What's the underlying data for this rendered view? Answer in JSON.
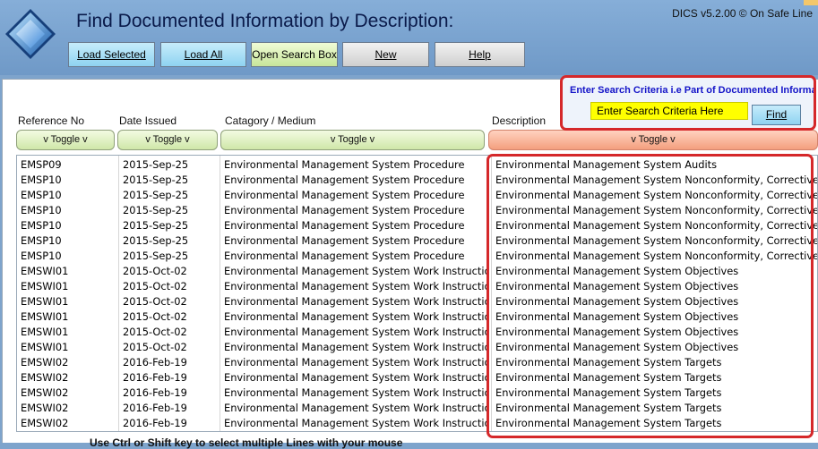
{
  "window": {
    "title": "Find Documented Information by Description:",
    "version": "DICS v5.2.00 © On Safe Line"
  },
  "toolbar": {
    "load_selected": "Load Selected",
    "load_all": "Load All",
    "open_search_box": "Open Search Box",
    "new": "New",
    "help": "Help"
  },
  "columns": {
    "reference": "Reference No",
    "date": "Date Issued",
    "category": "Catagory / Medium",
    "description": "Description",
    "toggle_label": "v Toggle v"
  },
  "search": {
    "label": "Enter Search Criteria i.e Part of Documented Information",
    "placeholder": "Enter Search Criteria Here",
    "find_label": "Find"
  },
  "rows": [
    {
      "ref": "EMSP09",
      "date": "2015-Sep-25",
      "cat": "Environmental Management System Procedure",
      "desc": "Environmental Management System Audits"
    },
    {
      "ref": "EMSP10",
      "date": "2015-Sep-25",
      "cat": "Environmental Management System Procedure",
      "desc": "Environmental Management System Nonconformity, Corrective Action"
    },
    {
      "ref": "EMSP10",
      "date": "2015-Sep-25",
      "cat": "Environmental Management System Procedure",
      "desc": "Environmental Management System Nonconformity, Corrective Action"
    },
    {
      "ref": "EMSP10",
      "date": "2015-Sep-25",
      "cat": "Environmental Management System Procedure",
      "desc": "Environmental Management System Nonconformity, Corrective Action"
    },
    {
      "ref": "EMSP10",
      "date": "2015-Sep-25",
      "cat": "Environmental Management System Procedure",
      "desc": "Environmental Management System Nonconformity, Corrective Action"
    },
    {
      "ref": "EMSP10",
      "date": "2015-Sep-25",
      "cat": "Environmental Management System Procedure",
      "desc": "Environmental Management System Nonconformity, Corrective Action"
    },
    {
      "ref": "EMSP10",
      "date": "2015-Sep-25",
      "cat": "Environmental Management System Procedure",
      "desc": "Environmental Management System Nonconformity, Corrective Action"
    },
    {
      "ref": "EMSWI01",
      "date": "2015-Oct-02",
      "cat": "Environmental Management System Work Instruction",
      "desc": "Environmental Management System Objectives"
    },
    {
      "ref": "EMSWI01",
      "date": "2015-Oct-02",
      "cat": "Environmental Management System Work Instruction",
      "desc": "Environmental Management System Objectives"
    },
    {
      "ref": "EMSWI01",
      "date": "2015-Oct-02",
      "cat": "Environmental Management System Work Instruction",
      "desc": "Environmental Management System Objectives"
    },
    {
      "ref": "EMSWI01",
      "date": "2015-Oct-02",
      "cat": "Environmental Management System Work Instruction",
      "desc": "Environmental Management System Objectives"
    },
    {
      "ref": "EMSWI01",
      "date": "2015-Oct-02",
      "cat": "Environmental Management System Work Instruction",
      "desc": "Environmental Management System Objectives"
    },
    {
      "ref": "EMSWI01",
      "date": "2015-Oct-02",
      "cat": "Environmental Management System Work Instruction",
      "desc": "Environmental Management System Objectives"
    },
    {
      "ref": "EMSWI02",
      "date": "2016-Feb-19",
      "cat": "Environmental Management System Work Instruction",
      "desc": "Environmental Management System Targets"
    },
    {
      "ref": "EMSWI02",
      "date": "2016-Feb-19",
      "cat": "Environmental Management System Work Instruction",
      "desc": "Environmental Management System Targets"
    },
    {
      "ref": "EMSWI02",
      "date": "2016-Feb-19",
      "cat": "Environmental Management System Work Instruction",
      "desc": "Environmental Management System Targets"
    },
    {
      "ref": "EMSWI02",
      "date": "2016-Feb-19",
      "cat": "Environmental Management System Work Instruction",
      "desc": "Environmental Management System Targets"
    },
    {
      "ref": "EMSWI02",
      "date": "2016-Feb-19",
      "cat": "Environmental Management System Work Instruction",
      "desc": "Environmental Management System Targets"
    }
  ],
  "footer": {
    "hint": "Use Ctrl or Shift key to select multiple Lines with your mouse"
  },
  "colors": {
    "background": "#7ea4cc",
    "highlight": "#d5282a",
    "search_input": "#ffff00",
    "toggle_green": "#cfe7a8",
    "toggle_orange": "#f49f7e"
  }
}
